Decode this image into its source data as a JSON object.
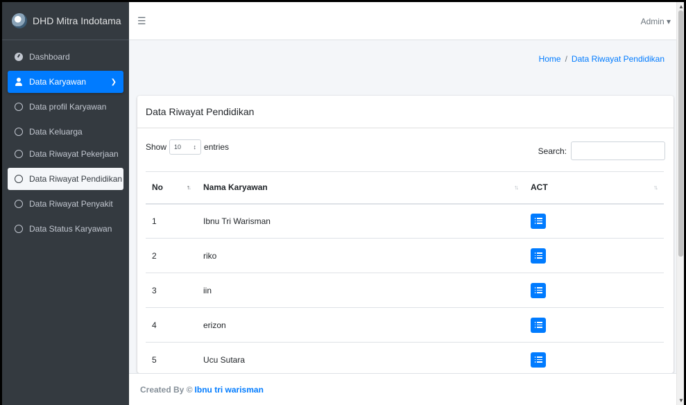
{
  "brand": {
    "title": "DHD Mitra Indotama"
  },
  "sidebar": {
    "items": [
      {
        "label": "Dashboard"
      },
      {
        "label": "Data Karyawan"
      },
      {
        "label": "Data profil Karyawan"
      },
      {
        "label": "Data Keluarga"
      },
      {
        "label": "Data Riwayat Pekerjaan"
      },
      {
        "label": "Data Riwayat Pendidikan"
      },
      {
        "label": "Data Riwayat Penyakit"
      },
      {
        "label": "Data Status Karyawan"
      }
    ]
  },
  "topbar": {
    "menu_icon": "☰",
    "user_label": "Admin ▾"
  },
  "breadcrumb": {
    "home": "Home",
    "separator": "/",
    "current": "Data Riwayat Pendidikan"
  },
  "card": {
    "title": "Data Riwayat Pendidikan",
    "show_label": "Show",
    "entries_value": "10",
    "entries_label": "entries",
    "search_label": "Search:",
    "search_value": ""
  },
  "table": {
    "headers": {
      "no": "No",
      "nama": "Nama Karyawan",
      "act": "ACT"
    },
    "rows": [
      {
        "no": "1",
        "nama": "Ibnu Tri Warisman"
      },
      {
        "no": "2",
        "nama": "riko"
      },
      {
        "no": "3",
        "nama": "iin"
      },
      {
        "no": "4",
        "nama": "erizon"
      },
      {
        "no": "5",
        "nama": "Ucu Sutara"
      }
    ]
  },
  "footer": {
    "prefix": "Created By ©",
    "author": "Ibnu tri warisman"
  },
  "colors": {
    "primary": "#007bff",
    "sidebar_bg": "#343a40"
  }
}
